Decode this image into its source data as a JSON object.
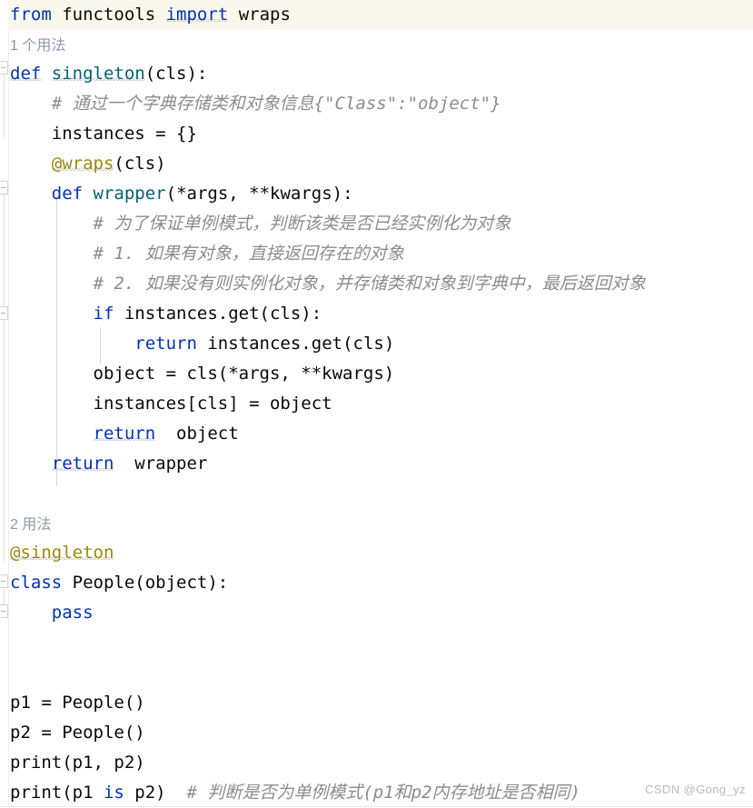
{
  "editor": {
    "language": "python",
    "watermark": "CSDN @Gong_yz",
    "colors": {
      "background": "#ffffff",
      "current_line_highlight": "#faf8ec",
      "keyword": "#0033b3",
      "function": "#00627a",
      "decorator": "#9e880d",
      "comment": "#8c8c8c",
      "text": "#080808",
      "inlay_hint": "#8e98a8",
      "gutter_border": "#eeeeee"
    }
  },
  "lines": {
    "l01": {
      "t1": "from",
      "t2": " functools ",
      "t3": "import",
      "t4": " wraps"
    },
    "hint1": "1 个用法",
    "l02": {
      "t1": "def",
      "t2": " ",
      "t3": "singleton",
      "t4": "(cls):"
    },
    "l03": "    # 通过一个字典存储类和对象信息{\"Class\":\"object\"}",
    "l04": "    instances = {}",
    "l05": {
      "t1": "    ",
      "t2": "@wraps",
      "t3": "(cls)"
    },
    "l06": {
      "t1": "    ",
      "t2": "def",
      "t3": " ",
      "t4": "wrapper",
      "t5": "(*args, **kwargs):"
    },
    "l07": "        # 为了保证单例模式，判断该类是否已经实例化为对象",
    "l08": "        # 1. 如果有对象，直接返回存在的对象",
    "l09": "        # 2. 如果没有则实例化对象，并存储类和对象到字典中，最后返回对象",
    "l10": {
      "t1": "        ",
      "t2": "if",
      "t3": " instances.get(cls):"
    },
    "l11": {
      "t1": "            ",
      "t2": "return",
      "t3": " instances.get(cls)"
    },
    "l12": "        object = cls(*args, **kwargs)",
    "l13": "        instances[cls] = object",
    "l14": {
      "t1": "        ",
      "t2": "return",
      "t3": "  object"
    },
    "l15": {
      "t1": "    ",
      "t2": "return",
      "t3": "  wrapper"
    },
    "l16": "",
    "hint2": "2 用法",
    "l17": "@singleton",
    "l18": {
      "t1": "class",
      "t2": " People(object):"
    },
    "l19": {
      "t1": "    ",
      "t2": "pass"
    },
    "l20": "",
    "l21": "",
    "l22": "p1 = People()",
    "l23": "p2 = People()",
    "l24": "print(p1, p2)",
    "l25": {
      "t1": "print(p1 ",
      "t2": "is",
      "t3": " p2)",
      "t4": "  # 判断是否为单例模式(p1和p2内存地址是否相同)"
    }
  }
}
